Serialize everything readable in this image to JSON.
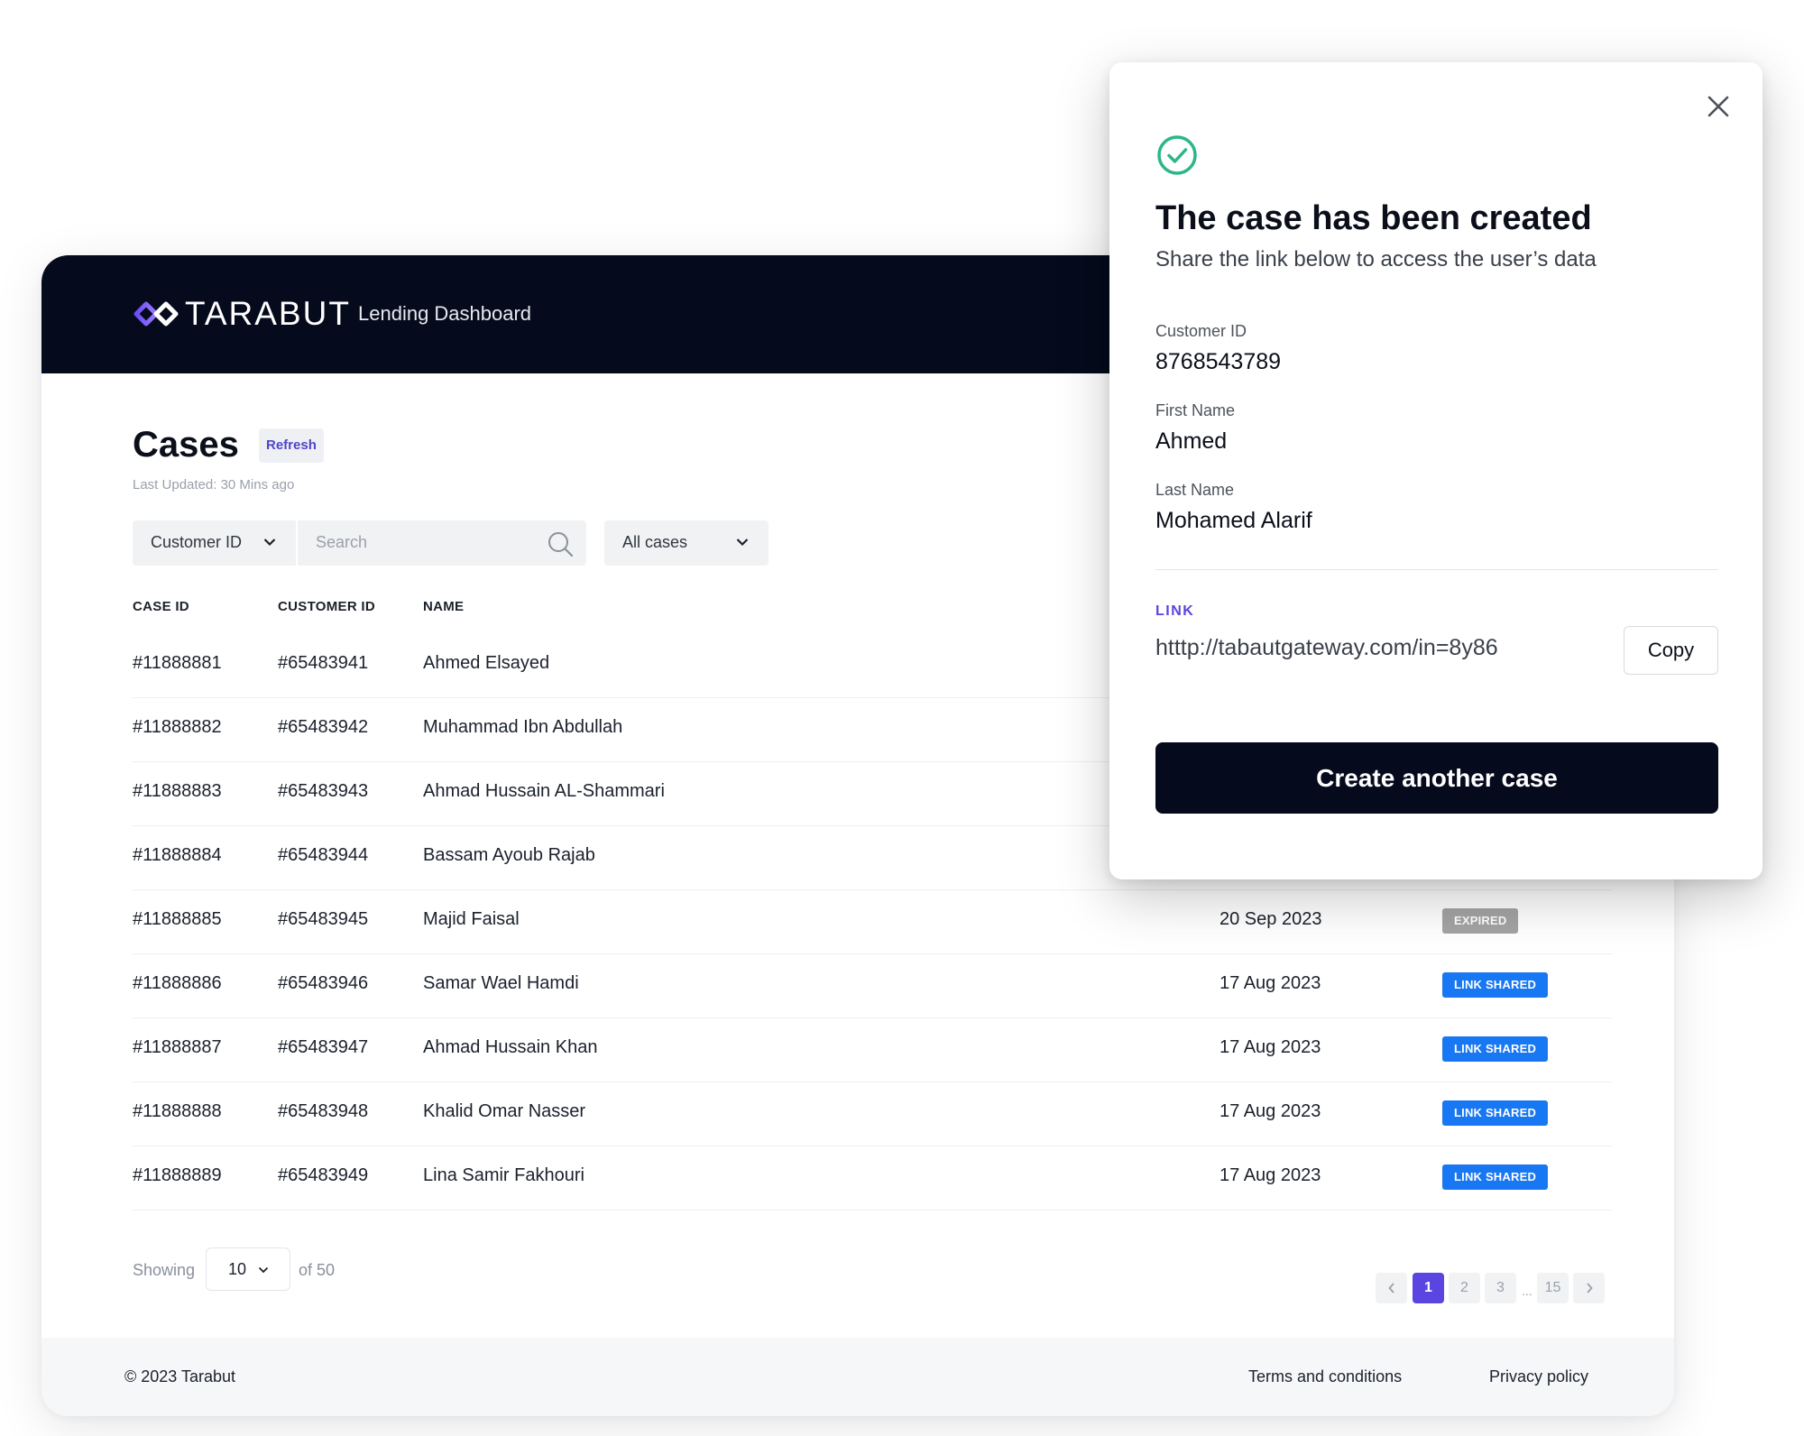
{
  "header": {
    "brand": "TARABUT",
    "app_title": "Lending Dashboard"
  },
  "page": {
    "title": "Cases",
    "refresh_label": "Refresh",
    "last_updated": "Last Updated: 30 Mins ago"
  },
  "filters": {
    "field_select": "Customer ID",
    "search_placeholder": "Search",
    "status_select": "All cases"
  },
  "table": {
    "headers": {
      "case_id": "CASE ID",
      "customer_id": "CUSTOMER ID",
      "name": "NAME"
    },
    "rows": [
      {
        "case_id": "#11888881",
        "customer_id": "#65483941",
        "name": "Ahmed Elsayed",
        "date": "",
        "status": ""
      },
      {
        "case_id": "#11888882",
        "customer_id": "#65483942",
        "name": "Muhammad Ibn Abdullah",
        "date": "",
        "status": ""
      },
      {
        "case_id": "#11888883",
        "customer_id": "#65483943",
        "name": "Ahmad Hussain AL-Shammari",
        "date": "",
        "status": ""
      },
      {
        "case_id": "#11888884",
        "customer_id": "#65483944",
        "name": "Bassam Ayoub Rajab",
        "date": "",
        "status": ""
      },
      {
        "case_id": "#11888885",
        "customer_id": "#65483945",
        "name": "Majid Faisal",
        "date": "20 Sep 2023",
        "status": "EXPIRED"
      },
      {
        "case_id": "#11888886",
        "customer_id": "#65483946",
        "name": "Samar Wael Hamdi",
        "date": "17 Aug 2023",
        "status": "LINK SHARED"
      },
      {
        "case_id": "#11888887",
        "customer_id": "#65483947",
        "name": "Ahmad Hussain Khan",
        "date": "17 Aug 2023",
        "status": "LINK SHARED"
      },
      {
        "case_id": "#11888888",
        "customer_id": "#65483948",
        "name": "Khalid Omar Nasser",
        "date": "17 Aug 2023",
        "status": "LINK SHARED"
      },
      {
        "case_id": "#11888889",
        "customer_id": "#65483949",
        "name": "Lina Samir Fakhouri",
        "date": "17 Aug 2023",
        "status": "LINK SHARED"
      }
    ]
  },
  "pagination": {
    "showing_label": "Showing",
    "per_page": "10",
    "of_total": "of 50",
    "pages": [
      "1",
      "2",
      "3",
      "15"
    ],
    "current_page": "1",
    "ellipsis": "..."
  },
  "footer": {
    "copyright": "© 2023 Tarabut",
    "terms": "Terms and conditions",
    "privacy": "Privacy policy"
  },
  "modal": {
    "title": "The case has been created",
    "subtitle": "Share the link below to access the user’s data",
    "customer_id_label": "Customer ID",
    "customer_id_value": "8768543789",
    "first_name_label": "First Name",
    "first_name_value": "Ahmed",
    "last_name_label": "Last Name",
    "last_name_value": "Mohamed Alarif",
    "link_label": "LINK",
    "link_value": "htttp://tabautgateway.com/in=8y86",
    "copy_label": "Copy",
    "create_label": "Create  another case"
  },
  "icons": {
    "close": "close-icon",
    "success": "check-circle-icon",
    "search": "search-icon",
    "dropdown": "chevron-down-icon",
    "prev": "chevron-left-icon",
    "next": "chevron-right-icon"
  },
  "colors": {
    "header_bg": "#050a1c",
    "accent": "#5b45e0",
    "success": "#2bb78a",
    "badge_shared": "#1877f2",
    "badge_expired": "#a4a4a4"
  }
}
